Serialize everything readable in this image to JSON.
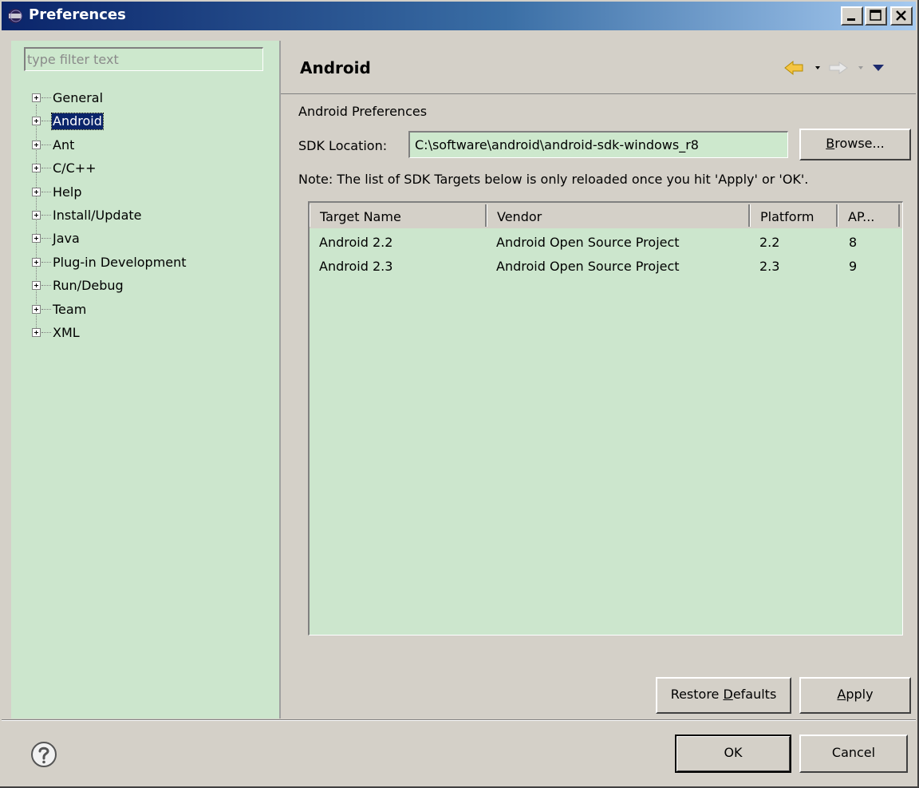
{
  "window": {
    "title": "Preferences",
    "icon": "eclipse-icon",
    "controls": [
      "minimize-icon",
      "maximize-icon",
      "close-icon"
    ]
  },
  "sidebar": {
    "filter_placeholder": "type filter text",
    "items": [
      {
        "label": "General",
        "selected": false
      },
      {
        "label": "Android",
        "selected": true
      },
      {
        "label": "Ant",
        "selected": false
      },
      {
        "label": "C/C++",
        "selected": false
      },
      {
        "label": "Help",
        "selected": false
      },
      {
        "label": "Install/Update",
        "selected": false
      },
      {
        "label": "Java",
        "selected": false
      },
      {
        "label": "Plug-in Development",
        "selected": false
      },
      {
        "label": "Run/Debug",
        "selected": false
      },
      {
        "label": "Team",
        "selected": false
      },
      {
        "label": "XML",
        "selected": false
      }
    ]
  },
  "page": {
    "title": "Android",
    "nav_icons": [
      "back-arrow-icon",
      "back-dropdown-icon",
      "forward-arrow-icon",
      "forward-dropdown-icon",
      "view-menu-icon"
    ],
    "section_label": "Android Preferences",
    "sdk_label": "SDK Location:",
    "sdk_value": "C:\\software\\android\\android-sdk-windows_r8",
    "browse_label_pre": "",
    "browse_label_mnemonic": "B",
    "browse_label_post": "rowse...",
    "note": "Note: The list of SDK Targets below is only reloaded once you hit 'Apply' or 'OK'.",
    "table": {
      "columns": [
        "Target Name",
        "Vendor",
        "Platform",
        "AP..."
      ],
      "rows": [
        [
          "Android 2.2",
          "Android Open Source Project",
          "2.2",
          "8"
        ],
        [
          "Android 2.3",
          "Android Open Source Project",
          "2.3",
          "9"
        ]
      ]
    },
    "restore_pre": "Restore ",
    "restore_mnemonic": "D",
    "restore_post": "efaults",
    "apply_mnemonic": "A",
    "apply_post": "pply"
  },
  "footer": {
    "help_icon": "help-icon",
    "ok_label": "OK",
    "cancel_label": "Cancel"
  },
  "colors": {
    "field_background": "#cce6cd",
    "title_bar": "#0a246a",
    "selection": "#0a246a",
    "back_arrow": "#f5c542"
  }
}
